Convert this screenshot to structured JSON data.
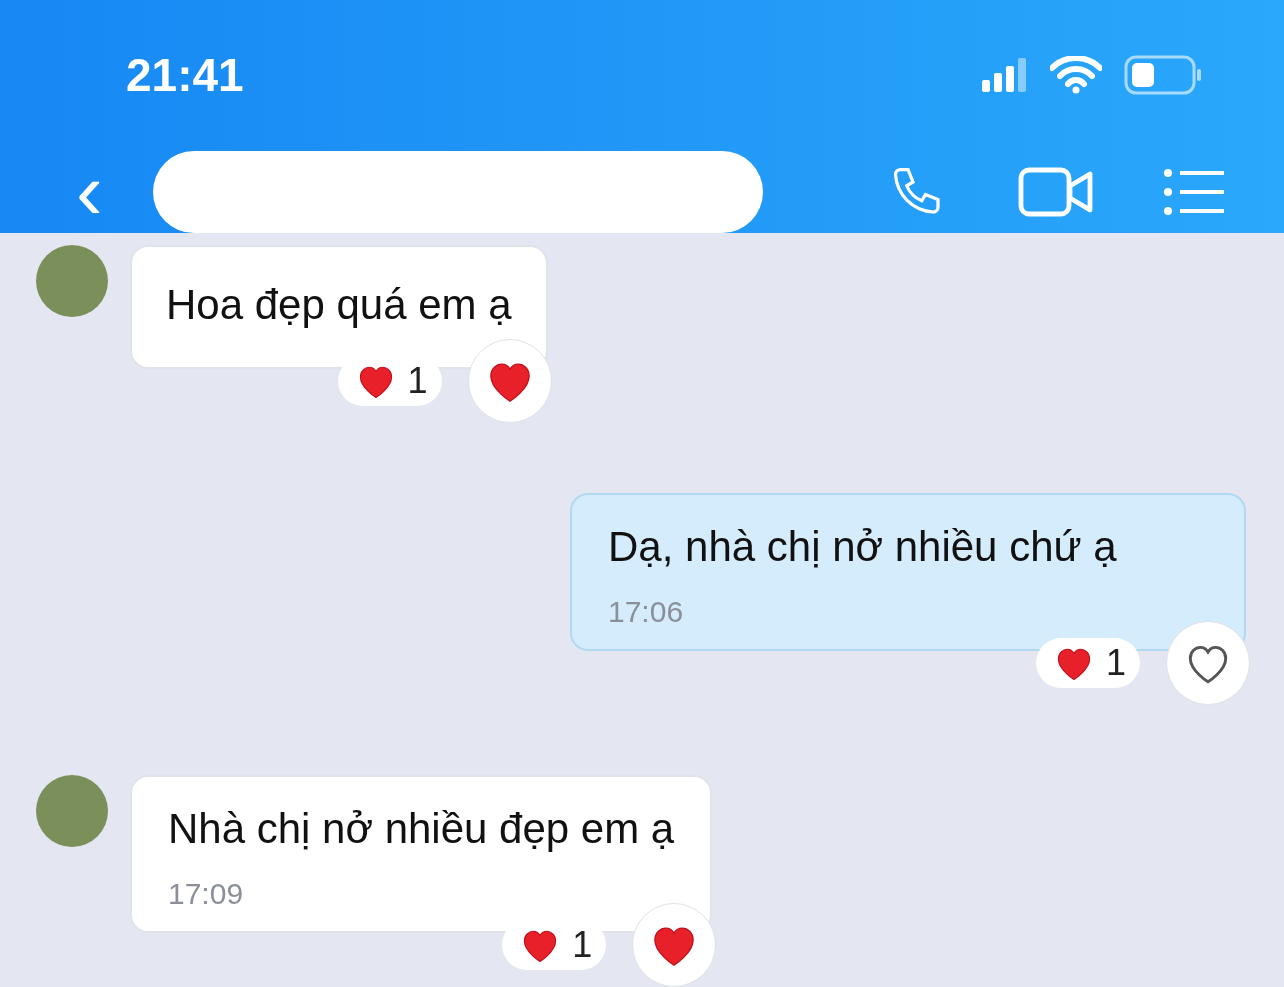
{
  "status_bar": {
    "time": "21:41"
  },
  "header": {
    "back": "‹"
  },
  "messages": [
    {
      "kind": "incoming",
      "text": "Hoa đẹp quá em ạ",
      "reaction_count": "1",
      "reacted": true
    },
    {
      "kind": "outgoing",
      "text": "Dạ, nhà chị nở nhiều chứ ạ",
      "time": "17:06",
      "reaction_count": "1",
      "reacted": false
    },
    {
      "kind": "incoming",
      "text": "Nhà chị nở nhiều đẹp em ạ",
      "time": "17:09",
      "reaction_count": "1",
      "reacted": true
    }
  ]
}
